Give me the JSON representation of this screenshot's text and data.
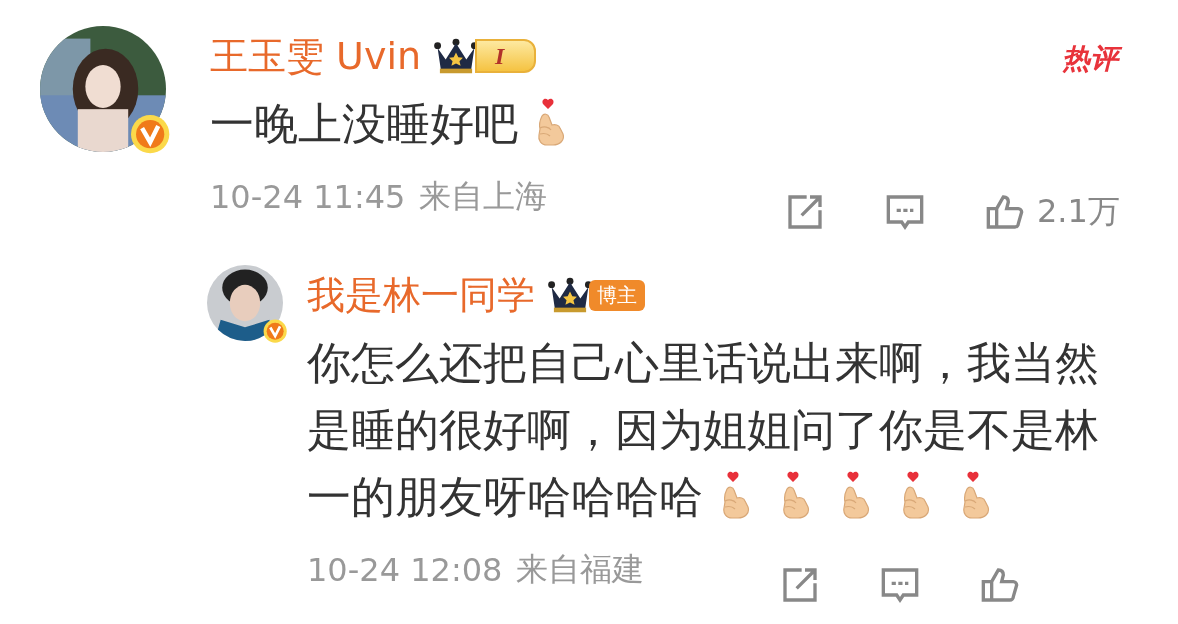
{
  "hot_label": "热评",
  "comment": {
    "author": "王玉雯 Uvin",
    "verified": true,
    "badge": {
      "kind": "level",
      "text": "I"
    },
    "content": [
      {
        "kind": "text",
        "text": "一晚上没睡好吧"
      },
      {
        "kind": "emoji"
      }
    ],
    "time": "10-24 11:45",
    "location": "来自上海",
    "like_count": "2.1万"
  },
  "reply": {
    "author": "我是林一同学",
    "verified": true,
    "badge": {
      "kind": "role",
      "text": "博主"
    },
    "content": [
      {
        "kind": "text",
        "text": "你怎么还把自己心里话说出来啊，我当然是睡的很好啊，因为姐姐问了你是不是林一的朋友呀哈哈哈哈"
      },
      {
        "kind": "emoji"
      },
      {
        "kind": "emoji"
      },
      {
        "kind": "emoji"
      },
      {
        "kind": "emoji"
      },
      {
        "kind": "emoji"
      }
    ],
    "time": "10-24 12:08",
    "location": "来自福建"
  }
}
